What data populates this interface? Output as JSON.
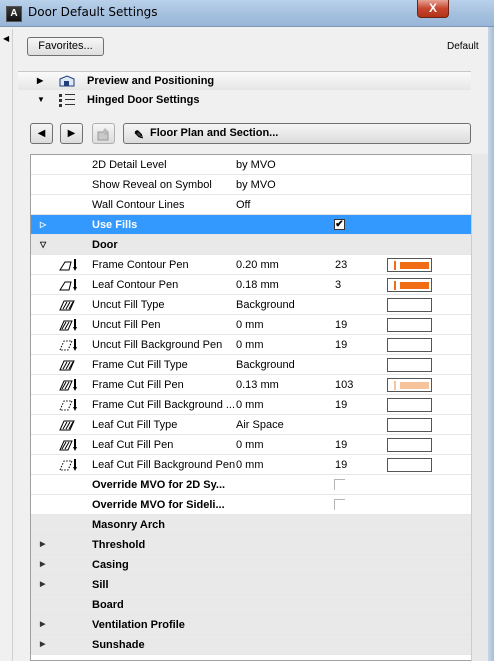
{
  "window": {
    "title": "Door Default Settings",
    "close_label": "X"
  },
  "top": {
    "favorites_label": "Favorites...",
    "default_label": "Default"
  },
  "sections": [
    {
      "label": "Preview and Positioning",
      "icon": "preview-icon",
      "expanded": false
    },
    {
      "label": "Hinged Door Settings",
      "icon": "hinged-door-icon",
      "expanded": true
    }
  ],
  "toolbar": {
    "prev_label": "◀",
    "next_label": "▶",
    "page_label": "Floor Plan and Section...",
    "page_icon": "pen-icon"
  },
  "rows": [
    {
      "name": "2D Detail Level",
      "value": "by MVO",
      "kind": "plain-mvo"
    },
    {
      "name": "Show Reveal on Symbol",
      "value": "by MVO",
      "kind": "plain-mvo"
    },
    {
      "name": "Wall Contour Lines",
      "value": "Off",
      "kind": "plain-mvo"
    },
    {
      "name": "Use Fills",
      "kind": "selected",
      "checked": true
    },
    {
      "name": "Door",
      "kind": "group-open"
    },
    {
      "name": "Frame Contour Pen",
      "value": "0.20 mm",
      "num": "23",
      "icon": "contour-pen-icon",
      "swatch": "orange"
    },
    {
      "name": "Leaf Contour Pen",
      "value": "0.18 mm",
      "num": "3",
      "icon": "contour-pen-icon",
      "swatch": "orange"
    },
    {
      "name": "Uncut Fill Type",
      "value": "Background",
      "icon": "fill-type-icon",
      "swatch": "empty"
    },
    {
      "name": "Uncut Fill Pen",
      "value": "0 mm",
      "num": "19",
      "icon": "fill-pen-icon",
      "swatch": "empty"
    },
    {
      "name": "Uncut Fill Background Pen",
      "value": "0 mm",
      "num": "19",
      "icon": "fill-bg-pen-icon",
      "swatch": "empty"
    },
    {
      "name": "Frame Cut Fill Type",
      "value": "Background",
      "icon": "fill-type-icon",
      "swatch": "empty"
    },
    {
      "name": "Frame Cut Fill Pen",
      "value": "0.13 mm",
      "num": "103",
      "icon": "fill-pen-icon",
      "swatch": "light"
    },
    {
      "name": "Frame Cut Fill Background ...",
      "value": "0 mm",
      "num": "19",
      "icon": "fill-bg-pen-icon",
      "swatch": "empty"
    },
    {
      "name": "Leaf Cut Fill Type",
      "value": "Air Space",
      "icon": "fill-type-icon",
      "swatch": "empty"
    },
    {
      "name": "Leaf Cut Fill Pen",
      "value": "0 mm",
      "num": "19",
      "icon": "fill-pen-icon",
      "swatch": "empty"
    },
    {
      "name": "Leaf Cut Fill Background Pen",
      "value": "0 mm",
      "num": "19",
      "icon": "fill-bg-pen-icon",
      "swatch": "empty"
    },
    {
      "name": "Override MVO for 2D Sy...",
      "kind": "override"
    },
    {
      "name": "Override MVO for Sideli...",
      "kind": "override"
    },
    {
      "name": "Masonry Arch",
      "kind": "group-none"
    },
    {
      "name": "Threshold",
      "kind": "group-closed"
    },
    {
      "name": "Casing",
      "kind": "group-closed"
    },
    {
      "name": "Sill",
      "kind": "group-closed"
    },
    {
      "name": "Board",
      "kind": "group-none"
    },
    {
      "name": "Ventilation Profile",
      "kind": "group-closed"
    },
    {
      "name": "Sunshade",
      "kind": "group-closed"
    }
  ],
  "colors": {
    "selection": "#3399ff",
    "pen_orange": "#f16d15",
    "pen_light": "#f7c39b"
  }
}
